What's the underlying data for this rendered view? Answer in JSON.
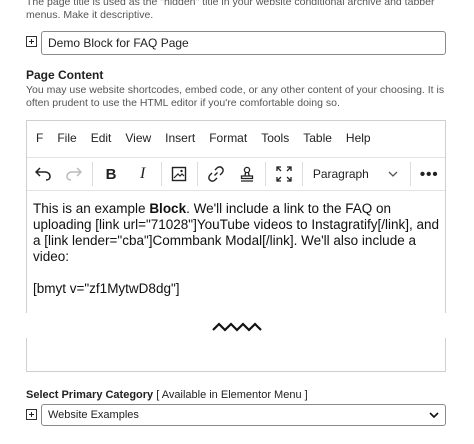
{
  "page_title_help": "The page title is used as the \"hidden\" title in your website conditional archive and tabber menus. Make it descriptive.",
  "page_title": {
    "value": "Demo Block for FAQ Page"
  },
  "page_content": {
    "label": "Page Content",
    "help": "You may use website shortcodes, embed code, or any other content of your choosing. It is often prudent to use the HTML editor if you're comfortable doing so."
  },
  "editor": {
    "menu": [
      "F",
      "File",
      "Edit",
      "View",
      "Insert",
      "Format",
      "Tools",
      "Table",
      "Help"
    ],
    "format_select": "Paragraph",
    "content": {
      "p1_before": "This is an example ",
      "p1_bold": "Block",
      "p1_after": ". We'll include a link to the FAQ on uploading [link url=\"71028\"]YouTube videos to Instagratify[/link], and a [link lender=\"cba\"]Commbank Modal[/link]. We'll also include a video:",
      "p2": "[bmyt v=\"zf1MytwD8dg\"]"
    }
  },
  "primary_category": {
    "label": "Select Primary Category",
    "note": "[ Available in Elementor Menu ]",
    "selected": "Website Examples"
  },
  "icons": {
    "expand": "plus-square-icon",
    "undo": "undo-icon",
    "redo": "redo-icon",
    "bold": "bold-icon",
    "italic": "italic-icon",
    "image": "image-icon",
    "link": "link-icon",
    "stamp": "stamp-icon",
    "fullscreen": "fullscreen-icon",
    "chevron": "chevron-down-icon",
    "more": "more-horizontal-icon"
  }
}
